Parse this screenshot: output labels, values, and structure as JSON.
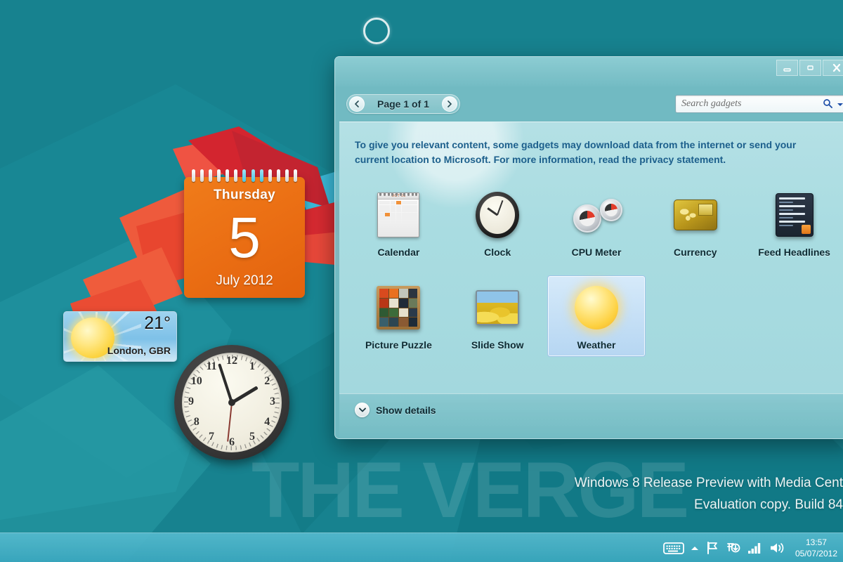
{
  "desktop": {
    "wallpaper_colors": {
      "teal_base": "#17828f",
      "teal_dark": "#0d6b77",
      "teal_light": "#2c98a3",
      "red": "#e8403a",
      "red_dark": "#c62a2e",
      "orange_red": "#ef5a3a",
      "cyan": "#3fc0e0"
    },
    "decor_circle": "circle-outline-decoration"
  },
  "calendar_gadget": {
    "weekday": "Thursday",
    "day": "5",
    "month_year": "July 2012",
    "color": "#ea6d13"
  },
  "weather_gadget": {
    "temperature": "21°",
    "location": "London, GBR",
    "icon": "sun-icon"
  },
  "clock_gadget": {
    "numbers": [
      "12",
      "1",
      "2",
      "3",
      "4",
      "5",
      "6",
      "7",
      "8",
      "9",
      "10",
      "11"
    ],
    "time_shown": "1:57"
  },
  "gadget_window": {
    "titlebar": {
      "minimize_label": "Minimize",
      "maximize_label": "Maximize",
      "close_label": "Close"
    },
    "toolbar": {
      "prev_label": "Previous page",
      "next_label": "Next page",
      "page_label": "Page 1 of 1",
      "search_placeholder": "Search gadgets",
      "search_value": "",
      "search_icon": "magnifier-icon",
      "dropdown_icon": "chevron-down-icon"
    },
    "privacy_notice": "To give you relevant content, some gadgets may download data from the internet or send your current location to Microsoft. For more information, read the privacy statement.",
    "gadgets": [
      {
        "label": "Calendar",
        "icon": "calendar-gadget-icon",
        "selected": false
      },
      {
        "label": "Clock",
        "icon": "clock-gadget-icon",
        "selected": false
      },
      {
        "label": "CPU Meter",
        "icon": "cpu-meter-gadget-icon",
        "selected": false
      },
      {
        "label": "Currency",
        "icon": "currency-gadget-icon",
        "selected": false
      },
      {
        "label": "Feed Headlines",
        "icon": "feed-gadget-icon",
        "selected": false
      },
      {
        "label": "Picture Puzzle",
        "icon": "puzzle-gadget-icon",
        "selected": false
      },
      {
        "label": "Slide Show",
        "icon": "slideshow-gadget-icon",
        "selected": false
      },
      {
        "label": "Weather",
        "icon": "weather-gadget-icon",
        "selected": true
      }
    ],
    "footer": {
      "show_details_label": "Show details",
      "chevron_icon": "chevron-down-icon"
    },
    "calendar_icon_month": "OCT 06"
  },
  "watermark": {
    "verge": "THE VERGE",
    "line1": "Windows 8 Release Preview with Media Cent",
    "line2": "Evaluation copy. Build 84"
  },
  "taskbar": {
    "tray_icons": [
      "keyboard-icon",
      "show-hidden-icons-chevron-up",
      "flag-action-center-icon",
      "network-sync-icon",
      "signal-bars-icon",
      "volume-icon"
    ],
    "clock_time": "13:57",
    "clock_date": "05/07/2012"
  }
}
